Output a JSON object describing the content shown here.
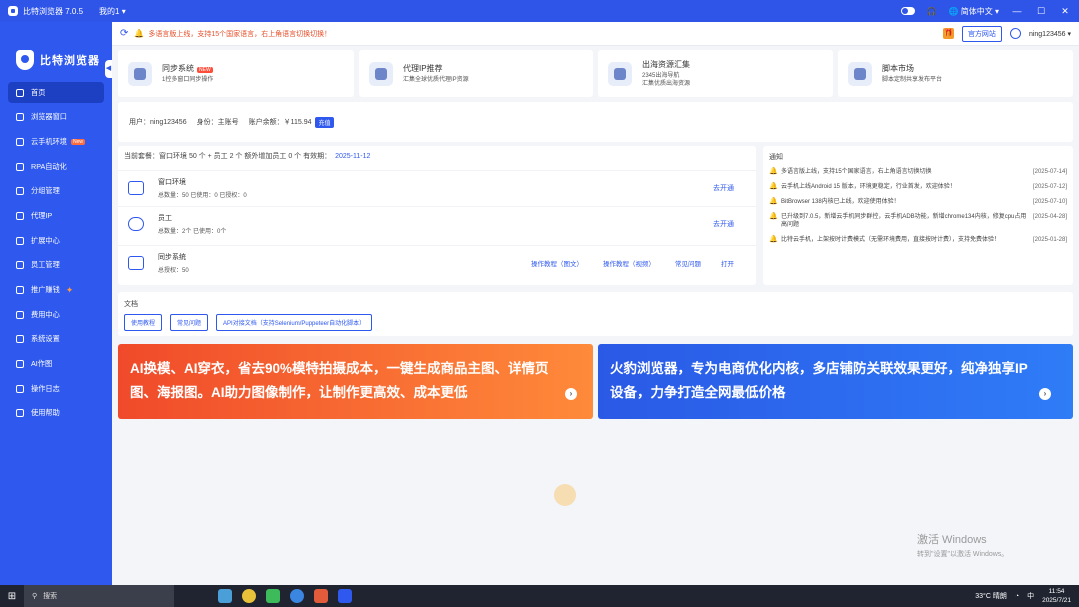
{
  "titlebar": {
    "title": "比特浏览器 7.0.5",
    "branch": "我的1",
    "language": "简体中文",
    "min": "—",
    "max": "☐",
    "close": "✕"
  },
  "sidebar": {
    "logo_text": "比特浏览器",
    "items": [
      {
        "label": "首页",
        "active": true
      },
      {
        "label": "浏览器窗口"
      },
      {
        "label": "云手机环境",
        "badge": "New"
      },
      {
        "label": "RPA自动化"
      },
      {
        "label": "分组管理"
      },
      {
        "label": "代理IP"
      },
      {
        "label": "扩展中心"
      },
      {
        "label": "员工管理"
      },
      {
        "label": "推广赚钱"
      },
      {
        "label": "费用中心"
      },
      {
        "label": "系统设置"
      },
      {
        "label": "AI作图"
      },
      {
        "label": "操作日志"
      },
      {
        "label": "使用帮助"
      }
    ]
  },
  "header": {
    "notice": "多语言版上线，支持15个国家语言，右上角语言切换切换！",
    "site_button": "官方网站",
    "username": "ning123456"
  },
  "feature_cards": [
    {
      "title": "同步系统",
      "new": "NEW",
      "desc": "1控多窗口同步操作"
    },
    {
      "title": "代理IP推荐",
      "desc": "汇集全球优质代理IP资源"
    },
    {
      "title": "出海资源汇集",
      "desc": "2345出海导航\n汇集优质出海资源"
    },
    {
      "title": "脚本市场",
      "desc": "脚本定制共享发布平台"
    }
  ],
  "account": {
    "user": "用户：ning123456",
    "role": "身份：主账号",
    "balance": "账户余额：￥115.94",
    "renew": "充值"
  },
  "package": {
    "header": "当前套餐：窗口环境 50 个 + 员工 2 个 额外增加员工 0 个 有效期：",
    "expiry": "2025-11-12",
    "rows": [
      {
        "title": "窗口环境",
        "detail": "总数量：50  已使用：0  已授权：0",
        "action": "去开通"
      },
      {
        "title": "员工",
        "detail": "总数量：2个  已使用：0个",
        "action": "去开通"
      },
      {
        "title": "同步系统",
        "detail": "总授权：50",
        "actions": [
          "操作教程（图文）",
          "操作教程（视频）",
          "常见问题",
          "打开"
        ]
      }
    ]
  },
  "notices": {
    "title": "通知",
    "items": [
      {
        "text": "多语言版上线，支持15个国家语言，右上角语言切换切换",
        "date": "[2025-07-14]",
        "hot": true
      },
      {
        "text": "云手机上线Android 15 版本，环境更稳定，行业首发，欢迎体验！",
        "date": "[2025-07-12]"
      },
      {
        "text": "BitBrowser 138内核已上线，欢迎使用体验！",
        "date": "[2025-07-10]"
      },
      {
        "text": "已升级到7.0.5，新增云手机同步群控，云手机ADB功能，新增chrome134内核，修复cpu占用高问题",
        "date": "[2025-04-28]"
      },
      {
        "text": "比特云手机，上架按时计费模式（无需环境费用，直接按时计费），支持免费体验！",
        "date": "[2025-01-28]"
      }
    ]
  },
  "docs": {
    "title": "文档",
    "buttons": [
      "使用教程",
      "常见问题",
      "API对接文档（支持Selenium/Puppeteer自动化脚本）"
    ]
  },
  "banners": [
    {
      "text": "AI换模、AI穿衣，省去90%模特拍摄成本，一键生成商品主图、详情页图、海报图。AI助力图像制作，让制作更高效、成本更低"
    },
    {
      "text": "火豹浏览器，专为电商优化内核，多店铺防关联效果更好，纯净独享IP设备，力争打造全网最低价格"
    }
  ],
  "watermark": {
    "line1": "激活 Windows",
    "line2": "转到\"设置\"以激活 Windows。"
  },
  "taskbar": {
    "search": "搜索",
    "weather": "33°C 晴朗",
    "ime": "中",
    "time": "11:54",
    "date": "2025/7/21"
  },
  "colors": {
    "brand": "#2e58ee",
    "notice": "#e6502b"
  }
}
